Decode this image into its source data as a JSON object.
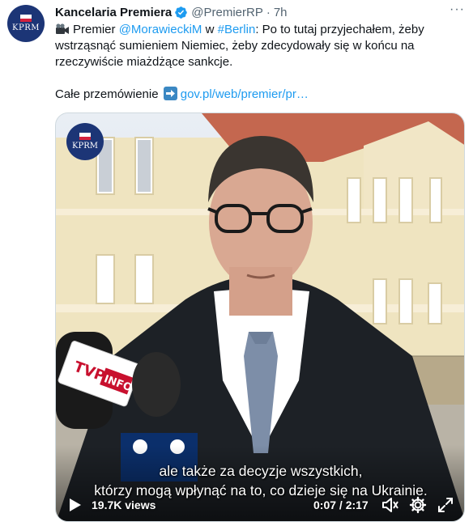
{
  "tweet": {
    "avatar_text": "KPRM",
    "author_name": "Kancelaria Premiera",
    "handle": "@PremierRP",
    "separator": "·",
    "time": "7h",
    "more": "···",
    "text_pre": "Premier ",
    "mention": "@MorawieckiM",
    "text_in": " w ",
    "hashtag": "#Berlin",
    "text_rest": ": Po to tutaj przyjechałem, żeby wstrząsnąć sumieniem Niemiec, żeby zdecydowały się w końcu na rzeczywiście miażdżące sankcje.",
    "link_intro": "Całe przemówienie",
    "link": "gov.pl/web/premier/pr…",
    "link_color": "#1d9bf0"
  },
  "video": {
    "logo_text": "KPRM",
    "subtitle_line1": "ale także za decyzje wszystkich,",
    "subtitle_line2": "którzy mogą wpłynąć na to, co dzieje się na Ukrainie.",
    "views": "19.7K views",
    "time": "0:07 / 2:17",
    "icons": [
      "play-icon",
      "volume-icon",
      "settings-gear-icon",
      "fullscreen-icon"
    ]
  }
}
